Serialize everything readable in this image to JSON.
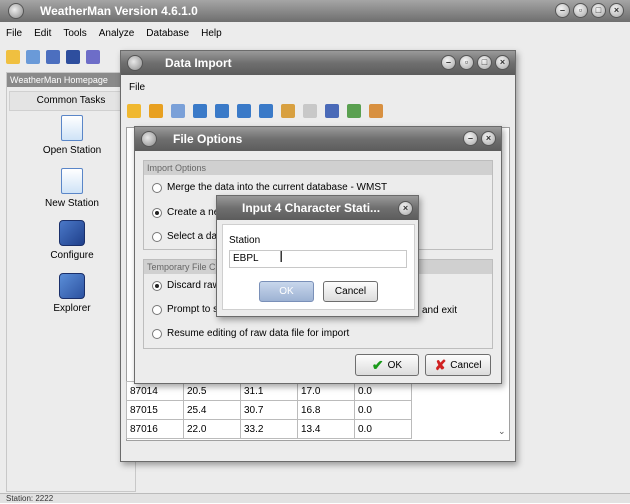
{
  "main": {
    "title": "WeatherMan Version 4.6.1.0",
    "menu": [
      "File",
      "Edit",
      "Tools",
      "Analyze",
      "Database",
      "Help"
    ],
    "homepage": "WeatherMan Homepage",
    "common_tasks": "Common Tasks",
    "tasks": [
      {
        "label": "Open Station",
        "icon": "open-station-icon"
      },
      {
        "label": "New Station",
        "icon": "new-station-icon"
      },
      {
        "label": "Configure",
        "icon": "configure-icon"
      },
      {
        "label": "Explorer",
        "icon": "explorer-icon"
      }
    ],
    "status": "Station: 2222"
  },
  "import": {
    "title": "Data Import",
    "menu": "File",
    "rows": [
      [
        "87014",
        "20.5",
        "31.1",
        "17.0",
        "0.0"
      ],
      [
        "87015",
        "25.4",
        "30.7",
        "16.8",
        "0.0"
      ],
      [
        "87016",
        "22.0",
        "33.2",
        "13.4",
        "0.0"
      ]
    ]
  },
  "file_options": {
    "title": "File Options",
    "group1": "Import Options",
    "opt1": "Merge the data into the current database - WMST",
    "opt2": "Create a new",
    "opt3": "Select a data",
    "group2": "Temporary File C",
    "opt4": "Discard raw",
    "opt5": "Prompt to sa",
    "opt5_tail": "and exit",
    "opt6": "Resume editing of raw data file for import",
    "ok": "OK",
    "cancel": "Cancel"
  },
  "input": {
    "title": "Input 4 Character Stati...",
    "label": "Station",
    "value": "EBPL",
    "ok": "OK",
    "cancel": "Cancel"
  }
}
